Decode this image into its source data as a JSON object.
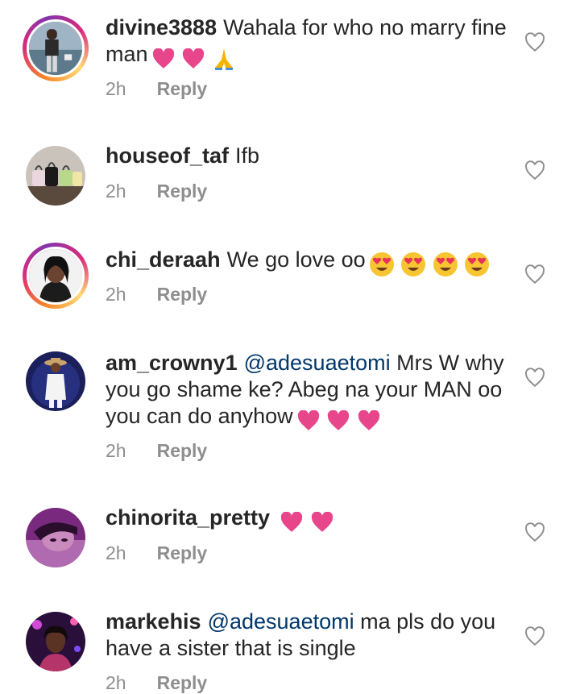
{
  "comments": [
    {
      "username": "divine3888",
      "text": "Wahala for who no marry fine man",
      "mention": "",
      "emojis": [
        "pink-heart",
        "pink-heart",
        "folded-hands"
      ],
      "time": "2h",
      "reply": "Reply",
      "story_ring": true,
      "avatar": "man-by-water-photo"
    },
    {
      "username": "houseof_taf",
      "text": "Ifb",
      "mention": "",
      "emojis": [],
      "time": "2h",
      "reply": "Reply",
      "story_ring": false,
      "avatar": "handbags-photo"
    },
    {
      "username": "chi_deraah",
      "text": "We go love oo",
      "mention": "",
      "emojis": [
        "heart-eyes",
        "heart-eyes",
        "heart-eyes",
        "heart-eyes"
      ],
      "time": "2h",
      "reply": "Reply",
      "story_ring": true,
      "avatar": "woman-portrait-photo"
    },
    {
      "username": "am_crowny1",
      "mention": "@adesuaetomi",
      "text": "Mrs W why you go shame ke? Abeg na your MAN oo you can do anyhow",
      "emojis": [
        "pink-heart",
        "pink-heart",
        "pink-heart"
      ],
      "time": "2h",
      "reply": "Reply",
      "story_ring": false,
      "avatar": "woman-hat-photo"
    },
    {
      "username": "chinorita_pretty",
      "text": "",
      "mention": "",
      "emojis": [
        "pink-heart",
        "pink-heart"
      ],
      "time": "2h",
      "reply": "Reply",
      "story_ring": false,
      "avatar": "purple-selfie-photo"
    },
    {
      "username": "markehis",
      "mention": "@adesuaetomi",
      "text": "ma pls do you have a sister that is single",
      "emojis": [],
      "time": "2h",
      "reply": "Reply",
      "story_ring": false,
      "avatar": "concert-lights-photo"
    }
  ],
  "colors": {
    "text": "#262626",
    "meta": "#8e8e8e",
    "mention": "#00376b",
    "heart_emoji": "#e8468b",
    "like_icon": "#8e8e8e"
  },
  "icons": {
    "like": "heart-outline-icon"
  }
}
